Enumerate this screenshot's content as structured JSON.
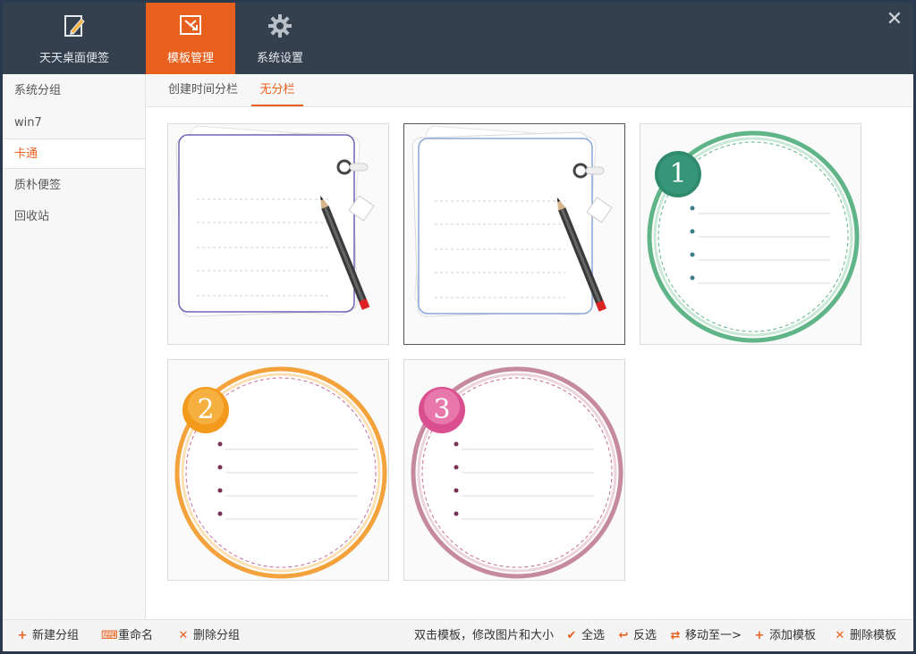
{
  "top_tabs": [
    {
      "label": "天天桌面便签",
      "icon": "pencil-note-icon"
    },
    {
      "label": "模板管理",
      "icon": "template-icon"
    },
    {
      "label": "系统设置",
      "icon": "gear-icon"
    }
  ],
  "active_top_tab": "模板管理",
  "sidebar": {
    "items": [
      {
        "label": "系统分组"
      },
      {
        "label": "win7"
      },
      {
        "label": "卡通"
      },
      {
        "label": "质朴便签"
      },
      {
        "label": "回收站"
      }
    ],
    "active": "卡通"
  },
  "subtabs": [
    {
      "label": "创建时间分栏"
    },
    {
      "label": "无分栏"
    }
  ],
  "active_subtab": "无分栏",
  "templates": [
    {
      "style": "purple-note-with-pencil",
      "selected": false
    },
    {
      "style": "blue-note-with-pencil",
      "selected": true
    },
    {
      "style": "green-circle",
      "number": "1",
      "selected": false
    },
    {
      "style": "orange-circle",
      "number": "2",
      "selected": false
    },
    {
      "style": "pink-circle",
      "number": "3",
      "selected": false
    }
  ],
  "bottom": {
    "new_group": "新建分组",
    "rename": "重命名",
    "delete_group": "删除分组",
    "hint": "双击模板，修改图片和大小",
    "select_all": "全选",
    "invert": "反选",
    "move_to": "移动至一>",
    "add_template": "添加模板",
    "delete_template": "删除模板"
  },
  "colors": {
    "accent": "#e8601d",
    "topbar": "#34404e",
    "green": "#5fb587",
    "orange": "#f3a23c",
    "pink": "#c58aa0"
  }
}
